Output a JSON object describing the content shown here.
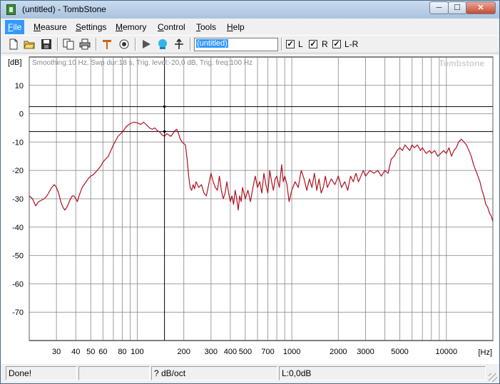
{
  "window": {
    "title": "(untitled) - TombStone"
  },
  "titlebar": {
    "min_glyph": "─",
    "max_glyph": "☐",
    "close_glyph": "✕"
  },
  "menu": {
    "items": [
      {
        "key": "F",
        "rest": "ile"
      },
      {
        "key": "M",
        "rest": "easure"
      },
      {
        "key": "S",
        "rest": "ettings"
      },
      {
        "key": "M",
        "rest": "emory"
      },
      {
        "key": "C",
        "rest": "ontrol"
      },
      {
        "key": "T",
        "rest": "ools"
      },
      {
        "key": "H",
        "rest": "elp"
      }
    ]
  },
  "toolbar": {
    "icons": [
      "new-file-icon",
      "open-folder-icon",
      "save-disk-icon",
      "copy-icon",
      "print-icon",
      "marker-icon",
      "target-icon",
      "play-icon",
      "sweep-icon",
      "pointer-icon"
    ],
    "name_value": "(untitled)",
    "checks": [
      {
        "label": "L",
        "checked": true
      },
      {
        "label": "R",
        "checked": true
      },
      {
        "label": "L-R",
        "checked": true
      }
    ]
  },
  "plot": {
    "info": "Smoothing:10 Hz, Swp dur:18 s, Trig. level:-20,0 dB, Trig. freq:100 Hz",
    "brand": "Tombstone",
    "y_unit": "[dB]",
    "x_unit": "[Hz]",
    "colors": {
      "curve": "#b01020",
      "grid": "#7f7f7f",
      "cursor": "#000000"
    }
  },
  "chart_data": {
    "type": "line",
    "xscale": "log",
    "xlim": [
      20,
      20000
    ],
    "ylim": [
      -80,
      20
    ],
    "xlabel": "[Hz]",
    "ylabel": "[dB]",
    "yticks": [
      "10",
      "0",
      "-10",
      "-20",
      "-30",
      "-40",
      "-50",
      "-60",
      "-70"
    ],
    "xticks": [
      "30",
      "40",
      "50",
      "60",
      "80",
      "100",
      "200",
      "300",
      "400",
      "500",
      "700",
      "1000",
      "2000",
      "3000",
      "5000",
      "10000"
    ],
    "grid": true,
    "cursor_hz": 150,
    "ref_lines_db": [
      2.5,
      -6.3
    ],
    "series": [
      {
        "values": [
          [
            20,
            -29
          ],
          [
            21,
            -30
          ],
          [
            22,
            -32.5
          ],
          [
            23,
            -31
          ],
          [
            24,
            -30.5
          ],
          [
            25,
            -30
          ],
          [
            26,
            -29
          ],
          [
            27,
            -27.5
          ],
          [
            28,
            -26
          ],
          [
            29,
            -25
          ],
          [
            30,
            -26
          ],
          [
            31,
            -28
          ],
          [
            32,
            -31
          ],
          [
            33,
            -33
          ],
          [
            34,
            -34
          ],
          [
            35,
            -33
          ],
          [
            36,
            -31.5
          ],
          [
            37,
            -30
          ],
          [
            38,
            -29
          ],
          [
            39,
            -29
          ],
          [
            40,
            -30
          ],
          [
            41,
            -31
          ],
          [
            42,
            -29
          ],
          [
            44,
            -26
          ],
          [
            46,
            -24.5
          ],
          [
            48,
            -23
          ],
          [
            50,
            -22
          ],
          [
            52,
            -21.5
          ],
          [
            55,
            -20
          ],
          [
            58,
            -18.5
          ],
          [
            60,
            -17
          ],
          [
            65,
            -15
          ],
          [
            70,
            -11
          ],
          [
            75,
            -8
          ],
          [
            80,
            -6.5
          ],
          [
            85,
            -4.5
          ],
          [
            90,
            -3.5
          ],
          [
            95,
            -3
          ],
          [
            100,
            -3.2
          ],
          [
            105,
            -3.8
          ],
          [
            110,
            -3
          ],
          [
            115,
            -4
          ],
          [
            120,
            -5
          ],
          [
            125,
            -5.5
          ],
          [
            130,
            -5
          ],
          [
            135,
            -6
          ],
          [
            140,
            -6.5
          ],
          [
            145,
            -7.5
          ],
          [
            150,
            -8
          ],
          [
            155,
            -7
          ],
          [
            160,
            -7.5
          ],
          [
            165,
            -8
          ],
          [
            170,
            -7
          ],
          [
            175,
            -6
          ],
          [
            180,
            -5.5
          ],
          [
            185,
            -7
          ],
          [
            190,
            -9
          ],
          [
            195,
            -10
          ],
          [
            200,
            -10.5
          ],
          [
            205,
            -11
          ],
          [
            210,
            -16
          ],
          [
            215,
            -22
          ],
          [
            220,
            -26
          ],
          [
            225,
            -27
          ],
          [
            230,
            -25
          ],
          [
            235,
            -26.5
          ],
          [
            240,
            -24
          ],
          [
            250,
            -26
          ],
          [
            260,
            -25
          ],
          [
            270,
            -28
          ],
          [
            280,
            -29
          ],
          [
            290,
            -25
          ],
          [
            300,
            -21
          ],
          [
            310,
            -24
          ],
          [
            320,
            -26
          ],
          [
            330,
            -27
          ],
          [
            340,
            -22
          ],
          [
            350,
            -27
          ],
          [
            360,
            -30
          ],
          [
            370,
            -28
          ],
          [
            380,
            -24
          ],
          [
            390,
            -28
          ],
          [
            400,
            -31
          ],
          [
            410,
            -29
          ],
          [
            420,
            -32
          ],
          [
            430,
            -27
          ],
          [
            440,
            -30
          ],
          [
            450,
            -34
          ],
          [
            460,
            -29
          ],
          [
            470,
            -31
          ],
          [
            480,
            -26
          ],
          [
            490,
            -28
          ],
          [
            500,
            -30
          ],
          [
            520,
            -27
          ],
          [
            540,
            -31
          ],
          [
            560,
            -26
          ],
          [
            580,
            -22
          ],
          [
            600,
            -26
          ],
          [
            620,
            -24
          ],
          [
            640,
            -28
          ],
          [
            660,
            -21
          ],
          [
            680,
            -25
          ],
          [
            700,
            -28
          ],
          [
            720,
            -20
          ],
          [
            740,
            -24
          ],
          [
            760,
            -27
          ],
          [
            780,
            -23
          ],
          [
            800,
            -22
          ],
          [
            830,
            -26
          ],
          [
            860,
            -18
          ],
          [
            880,
            -24
          ],
          [
            900,
            -22
          ],
          [
            930,
            -25
          ],
          [
            960,
            -31
          ],
          [
            1000,
            -27
          ],
          [
            1050,
            -24
          ],
          [
            1100,
            -26
          ],
          [
            1150,
            -20
          ],
          [
            1200,
            -23
          ],
          [
            1250,
            -27
          ],
          [
            1300,
            -23
          ],
          [
            1350,
            -26
          ],
          [
            1400,
            -21
          ],
          [
            1450,
            -27
          ],
          [
            1500,
            -23
          ],
          [
            1550,
            -28
          ],
          [
            1600,
            -26
          ],
          [
            1650,
            -22
          ],
          [
            1700,
            -26
          ],
          [
            1800,
            -23
          ],
          [
            1900,
            -25
          ],
          [
            2000,
            -22
          ],
          [
            2100,
            -26
          ],
          [
            2200,
            -24
          ],
          [
            2300,
            -27
          ],
          [
            2400,
            -22
          ],
          [
            2500,
            -24
          ],
          [
            2600,
            -21
          ],
          [
            2700,
            -24
          ],
          [
            2800,
            -22
          ],
          [
            2900,
            -20
          ],
          [
            3000,
            -22
          ],
          [
            3200,
            -20
          ],
          [
            3400,
            -21
          ],
          [
            3600,
            -20
          ],
          [
            3800,
            -22
          ],
          [
            4000,
            -20
          ],
          [
            4200,
            -21
          ],
          [
            4400,
            -16
          ],
          [
            4600,
            -15
          ],
          [
            4800,
            -13
          ],
          [
            5000,
            -12
          ],
          [
            5200,
            -13
          ],
          [
            5400,
            -11
          ],
          [
            5600,
            -12
          ],
          [
            5800,
            -13
          ],
          [
            6000,
            -11
          ],
          [
            6200,
            -12
          ],
          [
            6500,
            -11
          ],
          [
            6800,
            -13
          ],
          [
            7000,
            -12
          ],
          [
            7400,
            -14
          ],
          [
            7800,
            -13
          ],
          [
            8000,
            -14
          ],
          [
            8400,
            -13
          ],
          [
            8800,
            -15
          ],
          [
            9200,
            -14
          ],
          [
            9600,
            -13
          ],
          [
            10000,
            -14
          ],
          [
            10400,
            -12
          ],
          [
            10800,
            -15
          ],
          [
            11200,
            -13
          ],
          [
            11600,
            -12
          ],
          [
            12000,
            -10
          ],
          [
            12500,
            -9
          ],
          [
            13000,
            -10
          ],
          [
            13500,
            -11
          ],
          [
            14000,
            -13
          ],
          [
            14500,
            -15
          ],
          [
            15000,
            -18
          ],
          [
            15500,
            -20
          ],
          [
            16000,
            -22
          ],
          [
            16500,
            -24
          ],
          [
            17000,
            -27
          ],
          [
            17500,
            -29
          ],
          [
            18000,
            -32
          ],
          [
            18500,
            -33
          ],
          [
            19000,
            -35
          ],
          [
            19500,
            -36
          ],
          [
            20000,
            -38
          ]
        ]
      }
    ]
  },
  "status": {
    "state": "Done!",
    "empty": "",
    "slope": "? dB/oct",
    "level": "L:0,0dB"
  }
}
